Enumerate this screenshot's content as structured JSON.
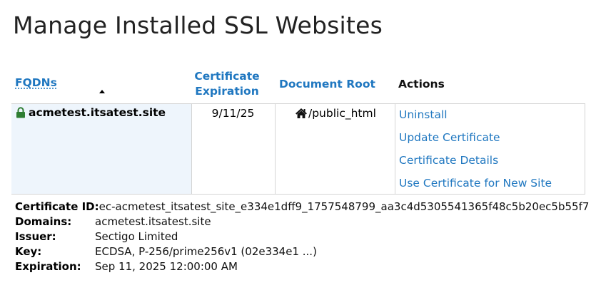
{
  "page": {
    "title": "Manage Installed SSL Websites"
  },
  "table": {
    "headers": {
      "fqdns": "FQDNs",
      "expiration_line1": "Certificate",
      "expiration_line2": "Expiration",
      "document_root": "Document Root",
      "actions": "Actions"
    },
    "sort": {
      "column": "fqdns",
      "direction": "ascending"
    },
    "rows": [
      {
        "fqdn": "acmetest.itsatest.site",
        "status_icon": "lock-icon",
        "expiration": "9/11/25",
        "document_root_icon": "home-icon",
        "document_root": "/public_html",
        "actions": [
          "Uninstall",
          "Update Certificate",
          "Certificate Details",
          "Use Certificate for New Site"
        ]
      }
    ]
  },
  "details": {
    "certificate_id_label": "Certificate ID:",
    "certificate_id": "ec-acmetest_itsatest_site_e334e1dff9_1757548799_aa3c4d5305541365f48c5b20ec5b55f7",
    "domains_label": "Domains:",
    "domains": "acmetest.itsatest.site",
    "issuer_label": "Issuer:",
    "issuer": "Sectigo Limited",
    "key_label": "Key:",
    "key": "ECDSA, P-256/prime256v1 (02e334e1 ...)",
    "expiration_label": "Expiration:",
    "expiration": "Sep 11, 2025 12:00:00 AM"
  },
  "colors": {
    "link": "#1f77c0",
    "lock": "#2e7d32",
    "row_highlight": "#eef5fc",
    "border": "#d4d4d4"
  }
}
